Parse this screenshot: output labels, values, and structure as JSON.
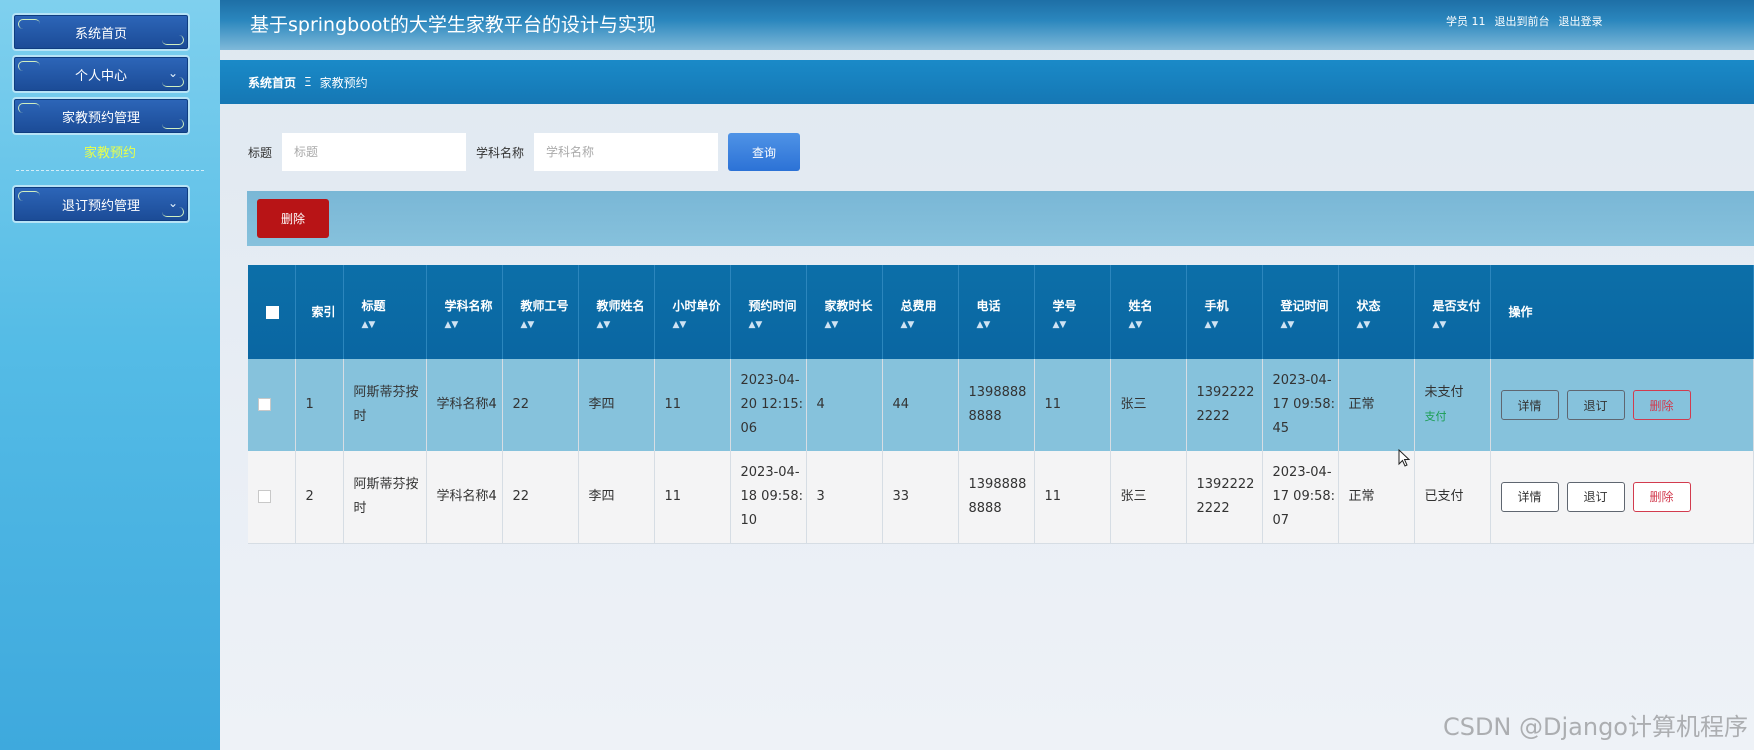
{
  "sidebar": {
    "items": [
      {
        "label": "系统首页"
      },
      {
        "label": "个人中心"
      },
      {
        "label": "家教预约管理"
      },
      {
        "label": "退订预约管理"
      }
    ],
    "active_sub": "家教预约"
  },
  "header": {
    "title": "基于springboot的大学生家教平台的设计与实现",
    "user": "学员 11",
    "front_link": "退出到前台",
    "logout_link": "退出登录"
  },
  "breadcrumb": {
    "home": "系统首页",
    "separator": "Ξ",
    "current": "家教预约"
  },
  "search": {
    "title_label": "标题",
    "title_placeholder": "标题",
    "subject_label": "学科名称",
    "subject_placeholder": "学科名称",
    "query_button": "查询"
  },
  "actions": {
    "delete_button": "删除"
  },
  "table": {
    "headers": [
      "索引",
      "标题",
      "学科名称",
      "教师工号",
      "教师姓名",
      "小时单价",
      "预约时间",
      "家教时长",
      "总费用",
      "电话",
      "学号",
      "姓名",
      "手机",
      "登记时间",
      "状态",
      "是否支付",
      "操作"
    ],
    "rows": [
      {
        "index": "1",
        "title": "阿斯蒂芬按时",
        "subject": "学科名称4",
        "teacher_id": "22",
        "teacher_name": "李四",
        "hourly_price": "11",
        "appoint_time": "2023-04-20 12:15:06",
        "duration": "4",
        "total": "44",
        "phone": "13988888888",
        "student_id": "11",
        "name": "张三",
        "mobile": "13922222222",
        "register_time": "2023-04-17 09:58:45",
        "status": "正常",
        "paid": "未支付",
        "pay_action": "支付"
      },
      {
        "index": "2",
        "title": "阿斯蒂芬按时",
        "subject": "学科名称4",
        "teacher_id": "22",
        "teacher_name": "李四",
        "hourly_price": "11",
        "appoint_time": "2023-04-18 09:58:10",
        "duration": "3",
        "total": "33",
        "phone": "13988888888",
        "student_id": "11",
        "name": "张三",
        "mobile": "13922222222",
        "register_time": "2023-04-17 09:58:07",
        "status": "正常",
        "paid": "已支付",
        "pay_action": ""
      }
    ],
    "row_buttons": {
      "detail": "详情",
      "unsubscribe": "退订",
      "delete": "删除"
    }
  },
  "watermark": "CSDN @Django计算机程序"
}
